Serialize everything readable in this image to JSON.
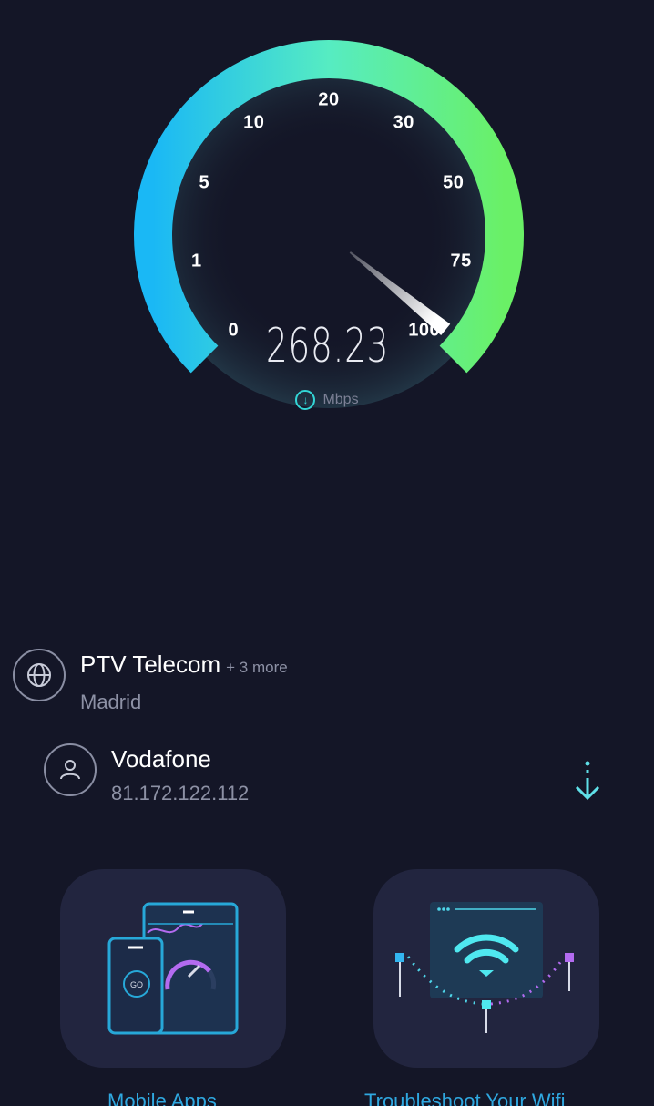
{
  "gauge": {
    "ticks": [
      "0",
      "1",
      "5",
      "10",
      "20",
      "30",
      "50",
      "75",
      "100"
    ],
    "speed": "268.23",
    "unit": "Mbps",
    "colors": {
      "start": "#1ab8f5",
      "mid": "#56e6c0",
      "end": "#66ee66",
      "needle": "#ffffff",
      "accent": "#33d6d6"
    }
  },
  "server": {
    "icon": "globe-icon",
    "name": "PTV Telecom",
    "more": "+ 3 more",
    "location": "Madrid"
  },
  "isp": {
    "icon": "user-icon",
    "name": "Vodafone",
    "ip": "81.172.122.112"
  },
  "result_indicator": {
    "icon": "download-arrow-icon"
  },
  "cards": [
    {
      "label": "Mobile Apps",
      "icon": "mobile-apps-icon"
    },
    {
      "label": "Troubleshoot Your Wifi",
      "icon": "wifi-troubleshoot-icon"
    }
  ]
}
